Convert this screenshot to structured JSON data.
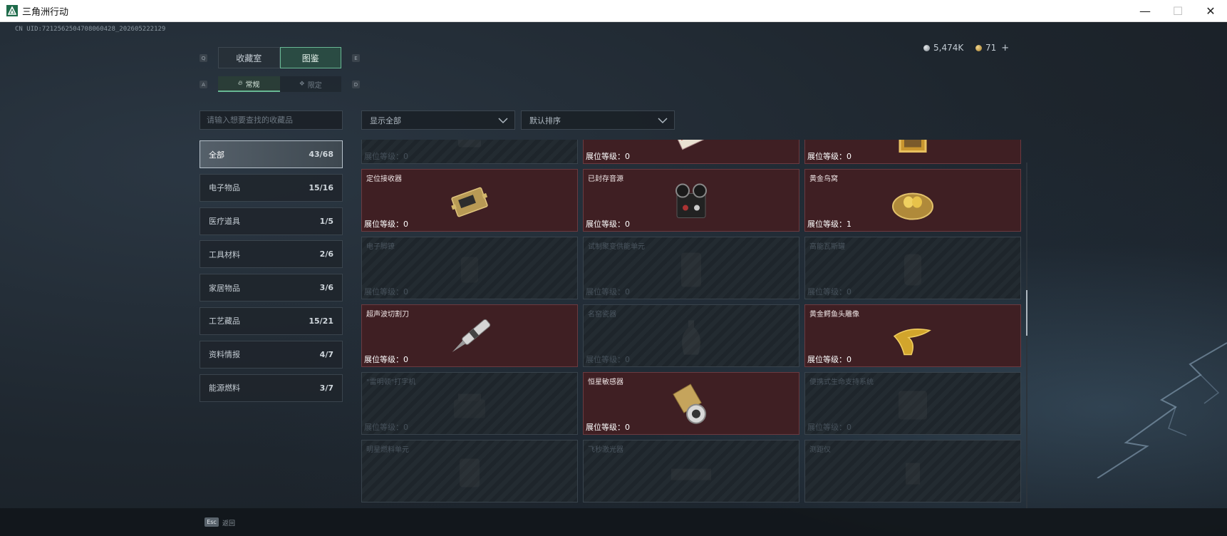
{
  "window": {
    "title": "三角洲行动",
    "icon": "delta-logo-icon"
  },
  "uid": "CN UID:721256250470806042​8_202605222129",
  "currency": [
    {
      "icon": "silver-coin-icon",
      "value": "5,474K",
      "color": "#c9ced3"
    },
    {
      "icon": "gold-coin-icon",
      "value": "71",
      "color": "#d6a948"
    }
  ],
  "hotkeys": {
    "prev_tab": "Q",
    "next_tab": "E",
    "prev_sub": "A",
    "next_sub": "D"
  },
  "main_tabs": [
    {
      "label": "收藏室",
      "active": false
    },
    {
      "label": "图鉴",
      "active": true
    }
  ],
  "sub_tabs": [
    {
      "label": "常规",
      "icon": "flame-icon",
      "active": true
    },
    {
      "label": "限定",
      "icon": "laurel-icon",
      "active": false
    }
  ],
  "search": {
    "placeholder": "请输入想要查找的收藏品"
  },
  "categories": [
    {
      "label": "全部",
      "count": "43/68",
      "active": true
    },
    {
      "label": "电子物品",
      "count": "15/16"
    },
    {
      "label": "医疗道具",
      "count": "1/5"
    },
    {
      "label": "工具材料",
      "count": "2/6"
    },
    {
      "label": "家居物品",
      "count": "3/6"
    },
    {
      "label": "工艺藏品",
      "count": "15/21"
    },
    {
      "label": "资料情报",
      "count": "4/7"
    },
    {
      "label": "能源燃料",
      "count": "3/7"
    }
  ],
  "filters": {
    "display": "显示全部",
    "sort": "默认排序"
  },
  "items": [
    {
      "name": "",
      "level": "展位等级：0",
      "owned": false,
      "icon": "device-icon"
    },
    {
      "name": "",
      "level": "展位等级：0",
      "owned": true,
      "icon": "card-icon"
    },
    {
      "name": "",
      "level": "展位等级：0",
      "owned": true,
      "icon": "painting-icon"
    },
    {
      "name": "定位接收器",
      "level": "展位等级：0",
      "owned": true,
      "icon": "receiver-icon"
    },
    {
      "name": "已封存音源",
      "level": "展位等级：0",
      "owned": true,
      "icon": "tape-recorder-icon"
    },
    {
      "name": "黄金鸟窝",
      "level": "展位等级：1",
      "owned": true,
      "icon": "golden-nest-icon"
    },
    {
      "name": "电子脚镣",
      "level": "展位等级：0",
      "owned": false,
      "icon": "anklet-icon"
    },
    {
      "name": "试制聚变供能单元",
      "level": "展位等级：0",
      "owned": false,
      "icon": "fusion-unit-icon"
    },
    {
      "name": "高能瓦斯罐",
      "level": "展位等级：0",
      "owned": false,
      "icon": "gas-canister-icon"
    },
    {
      "name": "超声波切割刀",
      "level": "展位等级：0",
      "owned": true,
      "icon": "ultrasonic-knife-icon"
    },
    {
      "name": "名窑瓷器",
      "level": "展位等级：0",
      "owned": false,
      "icon": "porcelain-vase-icon"
    },
    {
      "name": "黄金鳄鱼头雕像",
      "level": "展位等级：0",
      "owned": true,
      "icon": "golden-crocodile-icon"
    },
    {
      "name": "\"雷明顿\"打字机",
      "level": "展位等级：0",
      "owned": false,
      "icon": "typewriter-icon"
    },
    {
      "name": "恒星敏感器",
      "level": "展位等级：0",
      "owned": true,
      "icon": "star-sensor-icon"
    },
    {
      "name": "便携式生命支持系统",
      "level": "展位等级：0",
      "owned": false,
      "icon": "life-support-icon"
    },
    {
      "name": "明星燃料单元",
      "level": "",
      "owned": false,
      "icon": "fuel-cell-icon"
    },
    {
      "name": "飞秒激光器",
      "level": "",
      "owned": false,
      "icon": "laser-icon"
    },
    {
      "name": "测距仪",
      "level": "",
      "owned": false,
      "icon": "rangefinder-icon"
    }
  ],
  "footer": {
    "esc_key": "Esc",
    "esc_label": "返回"
  }
}
